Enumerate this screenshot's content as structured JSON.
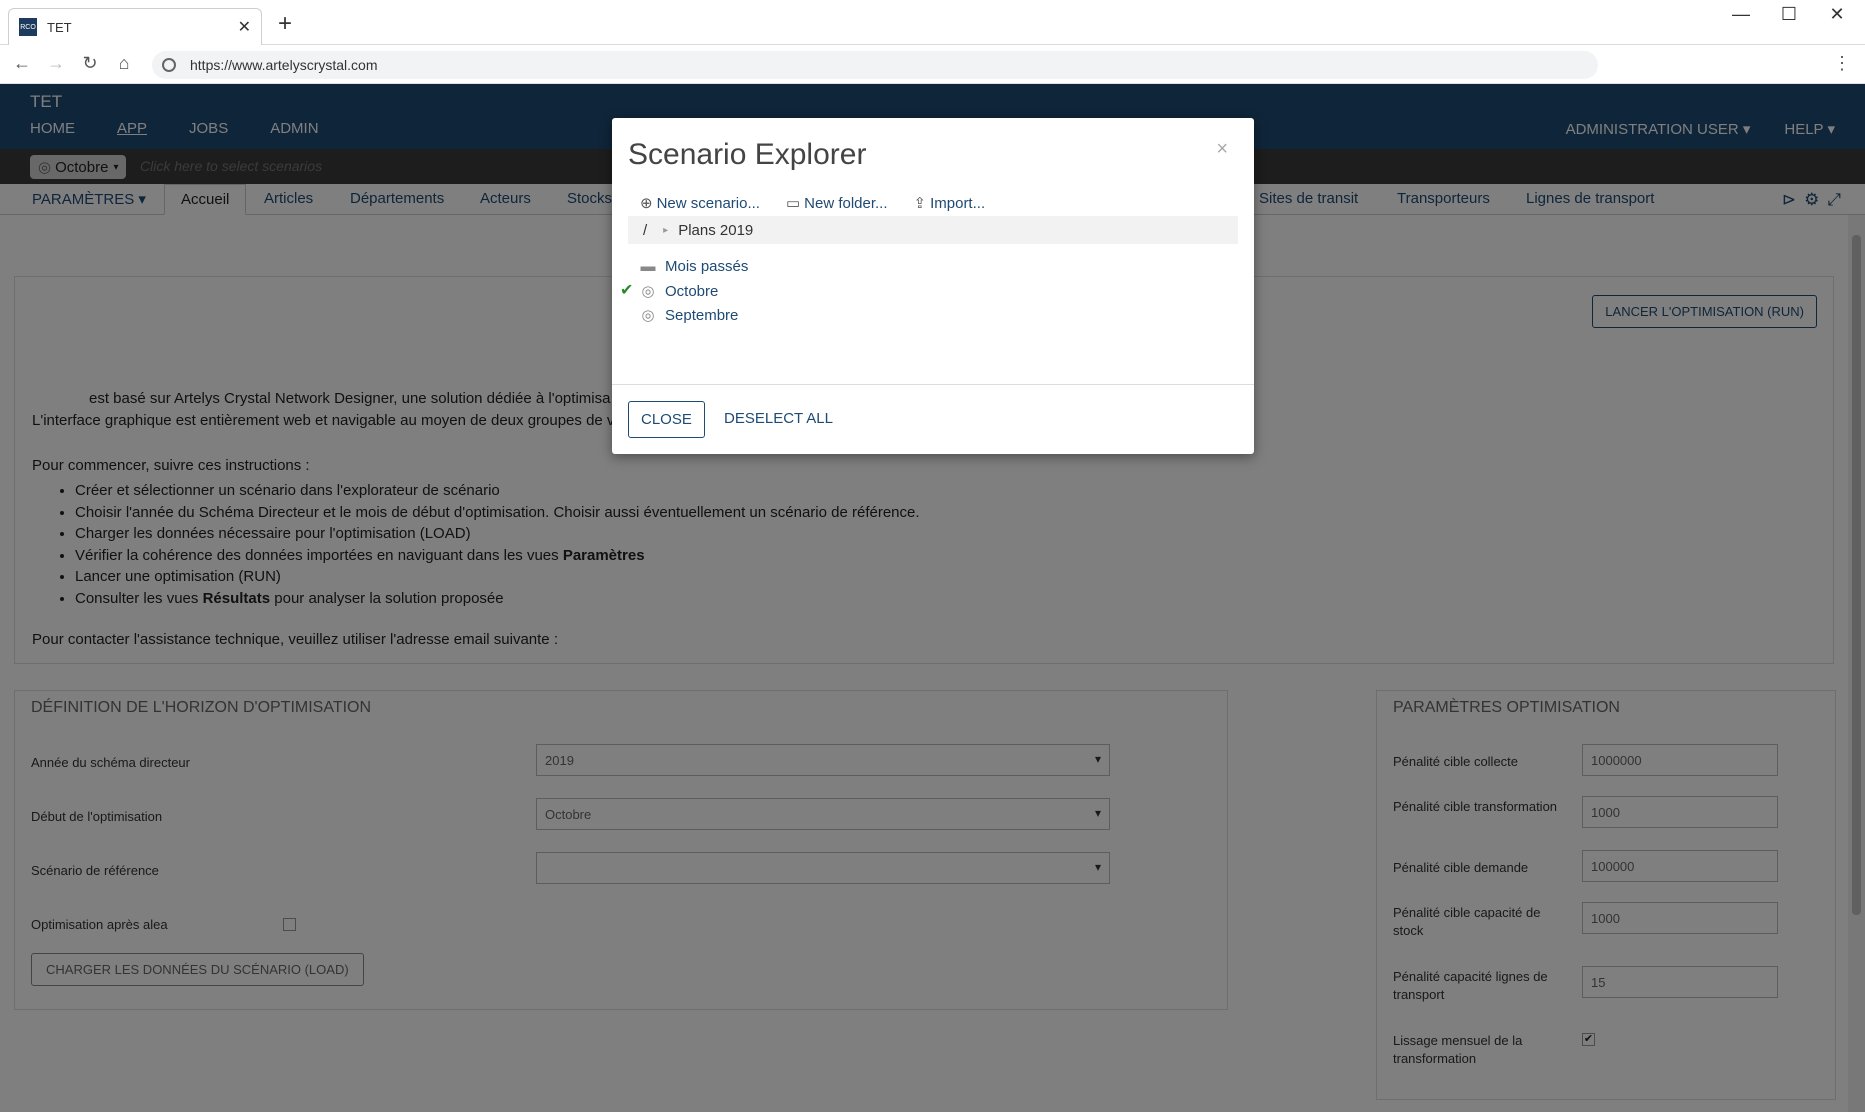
{
  "browser": {
    "tab_title": "TET",
    "favicon_text": "RCO",
    "url": "https://www.artelyscrystal.com"
  },
  "app": {
    "title": "TET",
    "nav": [
      "HOME",
      "APP",
      "JOBS",
      "ADMIN"
    ],
    "user_menu": "ADMINISTRATION USER",
    "help_menu": "HELP",
    "scenario_pill": "Octobre",
    "scenario_hint": "Click here to select scenarios"
  },
  "subnav": {
    "params_menu": "PARAMÈTRES",
    "active_tab": "Accueil",
    "tabs_left": [
      "Articles",
      "Départements",
      "Acteurs",
      "Stocks"
    ],
    "tabs_right": [
      "Sites de transit",
      "Transporteurs",
      "Lignes de transport"
    ]
  },
  "intro": {
    "run_button": "LANCER L'OPTIMISATION (RUN)",
    "line1": "est basé sur Artelys Crystal Network Designer, une solution dédiée à l'optimisa",
    "line2": "L'interface graphique est entièrement web et navigable au moyen de deux groupes de v",
    "start_text": "Pour commencer, suivre ces instructions :",
    "steps": [
      "Créer et sélectionner un scénario dans l'explorateur de scénario",
      "Choisir l'année du Schéma Directeur et le mois de début d'optimisation. Choisir aussi éventuellement un scénario de référence.",
      "Charger les données nécessaire pour l'optimisation (LOAD)",
      "Vérifier la cohérence des données importées en naviguant dans les vues",
      "Lancer une optimisation (RUN)",
      "Consulter les vues"
    ],
    "step4_bold": "Paramètres",
    "step6_bold": "Résultats",
    "step6_tail": " pour analyser la solution proposée",
    "contact": "Pour contacter l'assistance technique, veuillez utiliser l'adresse email suivante :"
  },
  "horizon": {
    "title": "DÉFINITION DE L'HORIZON D'OPTIMISATION",
    "year_label": "Année du schéma directeur",
    "year_value": "2019",
    "start_label": "Début de l'optimisation",
    "start_value": "Octobre",
    "ref_label": "Scénario de référence",
    "ref_value": "",
    "alea_label": "Optimisation après alea",
    "load_button": "CHARGER LES DONNÉES DU SCÉNARIO (LOAD)"
  },
  "params": {
    "title": "PARAMÈTRES OPTIMISATION",
    "rows": [
      {
        "label": "Pénalité cible collecte",
        "value": "1000000"
      },
      {
        "label": "Pénalité cible transformation",
        "value": "1000"
      },
      {
        "label": "Pénalité cible demande",
        "value": "100000"
      },
      {
        "label": "Pénalité cible capacité de stock",
        "value": "1000"
      },
      {
        "label": "Pénalité capacité lignes de transport",
        "value": "15"
      }
    ],
    "smoothing_label": "Lissage mensuel de la transformation",
    "smoothing_checked": true
  },
  "modal": {
    "title": "Scenario Explorer",
    "new_scenario": "New scenario...",
    "new_folder": "New folder...",
    "import": "Import...",
    "breadcrumb_root": "/",
    "breadcrumb_folder": "Plans 2019",
    "items": [
      {
        "label": "Mois passés",
        "icon": "folder-icon",
        "selected": false
      },
      {
        "label": "Octobre",
        "icon": "scenario-icon",
        "selected": true
      },
      {
        "label": "Septembre",
        "icon": "scenario-icon",
        "selected": false
      }
    ],
    "close_button": "CLOSE",
    "deselect_button": "DESELECT ALL"
  }
}
